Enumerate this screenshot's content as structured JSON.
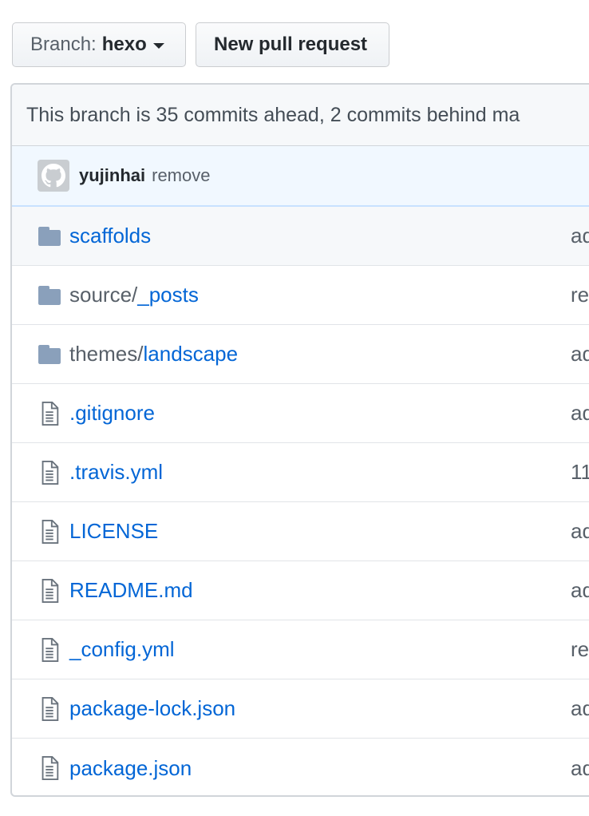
{
  "toolbar": {
    "branch_prefix": "Branch:",
    "branch_name": "hexo",
    "new_pr_label": "New pull request"
  },
  "ahead_message": "This branch is 35 commits ahead, 2 commits behind ma",
  "latest_commit": {
    "author": "yujinhai",
    "message": "remove"
  },
  "files": [
    {
      "type": "folder",
      "dir": "",
      "name": "scaffolds",
      "msg": "ad"
    },
    {
      "type": "folder",
      "dir": "source/",
      "name": "_posts",
      "msg": "re"
    },
    {
      "type": "folder",
      "dir": "themes/",
      "name": "landscape",
      "msg": "ad"
    },
    {
      "type": "file",
      "dir": "",
      "name": ".gitignore",
      "msg": "ad"
    },
    {
      "type": "file",
      "dir": "",
      "name": ".travis.yml",
      "msg": "11"
    },
    {
      "type": "file",
      "dir": "",
      "name": "LICENSE",
      "msg": "ad"
    },
    {
      "type": "file",
      "dir": "",
      "name": "README.md",
      "msg": "ad"
    },
    {
      "type": "file",
      "dir": "",
      "name": "_config.yml",
      "msg": "re"
    },
    {
      "type": "file",
      "dir": "",
      "name": "package-lock.json",
      "msg": "ad"
    },
    {
      "type": "file",
      "dir": "",
      "name": "package.json",
      "msg": "ad"
    }
  ],
  "icons": {
    "folder": "folder-icon",
    "file": "file-icon",
    "avatar": "github-octocat-icon",
    "caret": "caret-down-icon"
  },
  "colors": {
    "link": "#0366d6",
    "folder_icon": "#79b8ff",
    "muted": "#586069",
    "commit_bar_bg": "#f1f8ff"
  }
}
